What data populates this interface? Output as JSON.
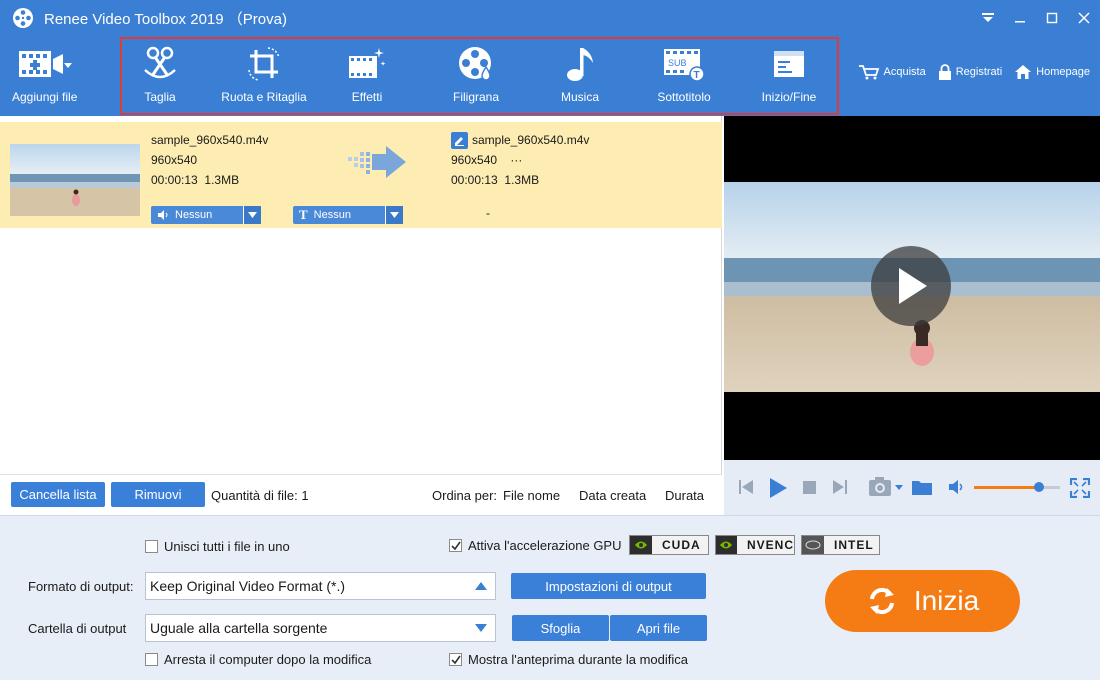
{
  "app": {
    "title": "Renee Video Toolbox 2019 （Prova)",
    "colors": {
      "primary": "#3b7fd4",
      "selection_row": "#fdedb2",
      "highlight_box": "#e03a3a",
      "start": "#f57c15"
    }
  },
  "toolbar": {
    "add_files": "Aggiungi file",
    "tools": [
      {
        "label": "Taglia",
        "icon": "scissors-icon"
      },
      {
        "label": "Ruota e Ritaglia",
        "icon": "crop-rotate-icon"
      },
      {
        "label": "Effetti",
        "icon": "effects-icon"
      },
      {
        "label": "Filigrana",
        "icon": "watermark-icon"
      },
      {
        "label": "Musica",
        "icon": "music-icon"
      },
      {
        "label": "Sottotitolo",
        "icon": "subtitle-icon"
      },
      {
        "label": "Inizio/Fine",
        "icon": "intro-outro-icon"
      }
    ],
    "links": {
      "buy": "Acquista",
      "register": "Registrati",
      "home": "Homepage"
    }
  },
  "file": {
    "source": {
      "name": "sample_960x540.m4v",
      "resolution": "960x540",
      "duration": "00:00:13",
      "size": "1.3MB"
    },
    "output": {
      "name": "sample_960x540.m4v",
      "resolution": "960x540",
      "extra": "···",
      "duration": "00:00:13",
      "size": "1.3MB"
    },
    "audio_track": "Nessun",
    "subtitle_track": "Nessun",
    "dash": "-"
  },
  "listbar": {
    "clear": "Cancella lista",
    "remove": "Rimuovi",
    "count": "Quantità di file: 1",
    "sort_by": "Ordina per:",
    "sort_options": [
      "File nome",
      "Data creata",
      "Durata"
    ]
  },
  "settings": {
    "merge": "Unisci tutti i file in uno",
    "gpu": "Attiva l'accelerazione GPU",
    "gpu_badges": [
      "CUDA",
      "NVENC",
      "INTEL"
    ],
    "format_label": "Formato di output:",
    "format_value": "Keep Original Video Format (*.)",
    "output_settings": "Impostazioni di output",
    "folder_label": "Cartella di output",
    "folder_value": "Uguale alla cartella sorgente",
    "browse": "Sfoglia",
    "open": "Apri file",
    "shutdown": "Arresta il computer dopo la modifica",
    "preview": "Mostra l'anteprima durante la modifica",
    "merge_checked": false,
    "gpu_checked": true,
    "shutdown_checked": false,
    "preview_checked": true
  },
  "start": "Inizia",
  "player": {
    "volume_level": 0.75
  }
}
